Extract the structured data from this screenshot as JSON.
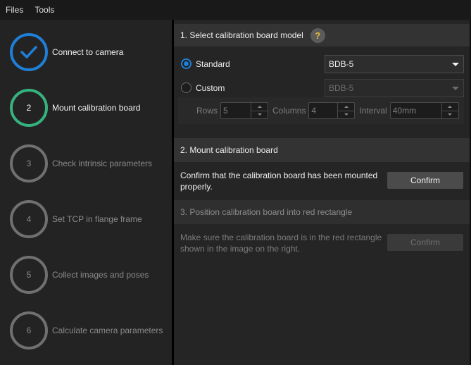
{
  "menubar": {
    "items": [
      "Files",
      "Tools"
    ]
  },
  "sidebar": {
    "steps": [
      {
        "number": "",
        "label": "Connect to camera",
        "state": "done",
        "icon": "check-icon"
      },
      {
        "number": "2",
        "label": "Mount calibration board",
        "state": "active"
      },
      {
        "number": "3",
        "label": "Check intrinsic parameters",
        "state": "pending"
      },
      {
        "number": "4",
        "label": "Set TCP in flange frame",
        "state": "pending"
      },
      {
        "number": "5",
        "label": "Collect images and poses",
        "state": "pending"
      },
      {
        "number": "6",
        "label": "Calculate camera parameters",
        "state": "pending"
      }
    ]
  },
  "section1": {
    "title": "1. Select calibration board model",
    "help_icon": "question-mark-icon",
    "help_glyph": "?",
    "standard_label": "Standard",
    "standard_checked": true,
    "standard_value": "BDB-5",
    "custom_label": "Custom",
    "custom_checked": false,
    "custom_value": "BDB-5",
    "rows_label": "Rows",
    "rows_value": "5",
    "columns_label": "Columns",
    "columns_value": "4",
    "interval_label": "Interval",
    "interval_value": "40mm"
  },
  "section2": {
    "title": "2. Mount calibration board",
    "description": "Confirm that the calibration board has been mounted properly.",
    "button": "Confirm"
  },
  "section3": {
    "title": "3. Position calibration board into red rectangle",
    "description": "Make sure the calibration board is in the red rectangle shown in the image on the right.",
    "button": "Confirm"
  },
  "colors": {
    "done": "#1f7fd6",
    "active": "#35b27d",
    "pending": "#707070",
    "help": "#e8b93b"
  }
}
